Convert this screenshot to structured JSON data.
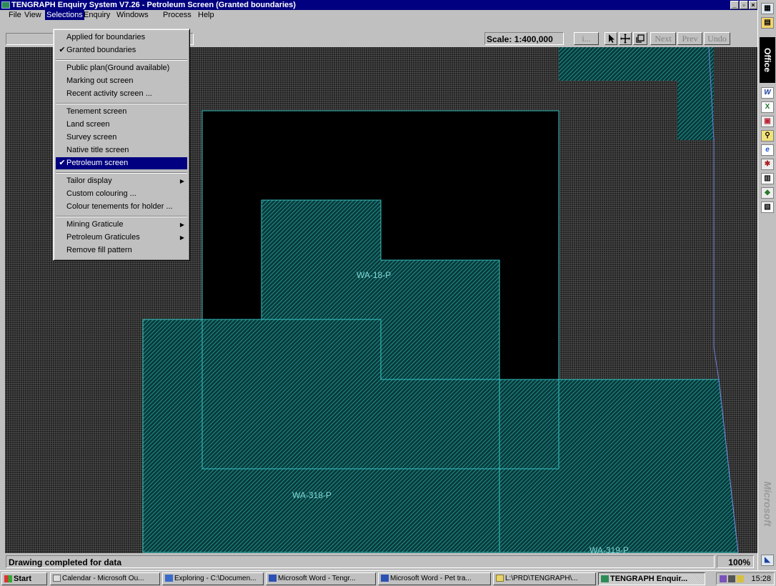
{
  "window": {
    "title": "TENGRAPH Enquiry System V7.26 - Petroleum Screen (Granted boundaries)",
    "controls": [
      "_",
      "▫",
      "×"
    ]
  },
  "menu": {
    "items": [
      "File",
      "View",
      "Selections",
      "Enquiry",
      "Windows",
      "Process",
      "Help"
    ],
    "active": "Selections"
  },
  "toolbar": {
    "scale": "Scale: 1:400,000",
    "info_btn": "i...",
    "next": "Next",
    "prev": "Prev",
    "undo": "Undo"
  },
  "dropdown": {
    "items": [
      {
        "label": "Applied for boundaries",
        "checked": false
      },
      {
        "label": "Granted boundaries",
        "checked": true
      },
      {
        "label": "Public plan(Ground available)",
        "checked": false
      },
      {
        "label": "Marking out screen",
        "checked": false
      },
      {
        "label": "Recent activity screen ...",
        "checked": false
      },
      {
        "label": "Tenement screen",
        "checked": false
      },
      {
        "label": "Land screen",
        "checked": false
      },
      {
        "label": "Survey screen",
        "checked": false
      },
      {
        "label": "Native title screen",
        "checked": false
      },
      {
        "label": "Petroleum screen",
        "checked": true,
        "highlighted": true
      },
      {
        "label": "Tailor display",
        "submenu": true
      },
      {
        "label": "Custom colouring ...",
        "checked": false
      },
      {
        "label": "Colour tenements for holder ...",
        "checked": false
      },
      {
        "label": "Mining Graticule",
        "submenu": true
      },
      {
        "label": "Petroleum Graticules",
        "submenu": true
      },
      {
        "label": "Remove fill pattern",
        "checked": false
      }
    ]
  },
  "map": {
    "labels": [
      "WA-18-P",
      "WA-318-P",
      "WA-319-P"
    ],
    "colors": {
      "boundary": "#36c2c2",
      "hatch": "#2aa6a6",
      "fill": "#000000"
    }
  },
  "status": {
    "text": "Drawing completed for  data",
    "zoom": "100%"
  },
  "office_bar": {
    "label": "Office",
    "brand": "Microsoft",
    "icons": [
      "office-open-icon",
      "word-icon",
      "excel-icon",
      "powerpoint-icon",
      "find-icon",
      "internet-explorer-icon",
      "access-icon",
      "schedule-icon",
      "publisher-icon",
      "binder-icon",
      "bottom-arrow-icon"
    ]
  },
  "taskbar": {
    "start": "Start",
    "tasks": [
      "Calendar - Microsoft Ou...",
      "Exploring - C:\\Documen...",
      "Microsoft Word - Tengr...",
      "Microsoft Word - Pet tra...",
      "L:\\PRD\\TENGRAPH\\...",
      "TENGRAPH Enquir..."
    ],
    "active_task": "TENGRAPH Enquir...",
    "clock": "15:28"
  }
}
